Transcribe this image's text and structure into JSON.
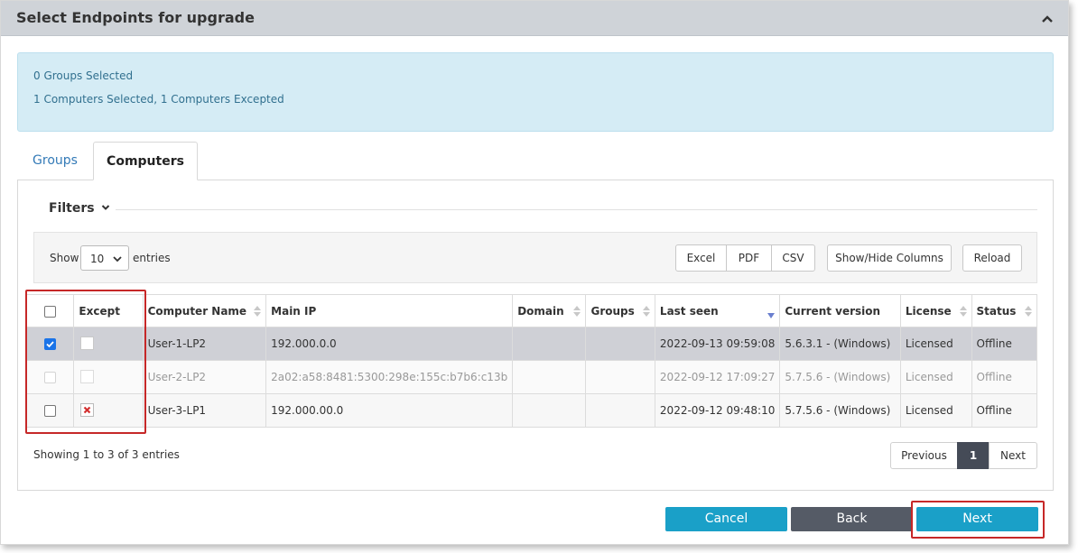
{
  "panel": {
    "title": "Select Endpoints for upgrade",
    "collapse_icon": "chevron-up-icon"
  },
  "summary": {
    "groups_line": "0 Groups Selected",
    "computers_line": "1 Computers Selected, 1 Computers Excepted"
  },
  "tabs": [
    {
      "label": "Groups",
      "active": false
    },
    {
      "label": "Computers",
      "active": true
    }
  ],
  "filters": {
    "label": "Filters",
    "icon": "chevron-down-icon"
  },
  "toolbar": {
    "show_label": "Show",
    "entries_value": "10",
    "entries_label": "entries",
    "excel": "Excel",
    "pdf": "PDF",
    "csv": "CSV",
    "show_hide": "Show/Hide Columns",
    "reload": "Reload"
  },
  "table": {
    "headers": {
      "except": "Except",
      "computer_name": "Computer Name",
      "main_ip": "Main IP",
      "domain": "Domain",
      "groups": "Groups",
      "last_seen": "Last seen",
      "current_version": "Current version",
      "license": "License",
      "status": "Status"
    },
    "rows": [
      {
        "selected": true,
        "excepted": false,
        "name": "User-1-LP2",
        "ip": "192.000.0.0",
        "domain": "",
        "groups": "",
        "last_seen": "2022-09-13 09:59:08",
        "version": "5.6.3.1 - (Windows)",
        "license": "Licensed",
        "status": "Offline"
      },
      {
        "selected": false,
        "excepted": false,
        "name": "User-2-LP2",
        "ip": "2a02:a58:8481:5300:298e:155c:b7b6:c13b",
        "domain": "",
        "groups": "",
        "last_seen": "2022-09-12 17:09:27",
        "version": "5.7.5.6 - (Windows)",
        "license": "Licensed",
        "status": "Offline"
      },
      {
        "selected": false,
        "excepted": true,
        "name": "User-3-LP1",
        "ip": "192.000.00.0",
        "domain": "",
        "groups": "",
        "last_seen": "2022-09-12 09:48:10",
        "version": "5.7.5.6 - (Windows)",
        "license": "Licensed",
        "status": "Offline"
      }
    ]
  },
  "footer": {
    "info": "Showing 1 to 3 of 3 entries"
  },
  "pager": {
    "previous": "Previous",
    "current": "1",
    "next": "Next"
  },
  "actions": {
    "cancel": "Cancel",
    "back": "Back",
    "next": "Next"
  },
  "colors": {
    "accent": "#1aa0c8",
    "dark": "#555b66",
    "licensed": "#3c9b3c",
    "offline": "#c9302c",
    "highlight": "#c62828"
  }
}
